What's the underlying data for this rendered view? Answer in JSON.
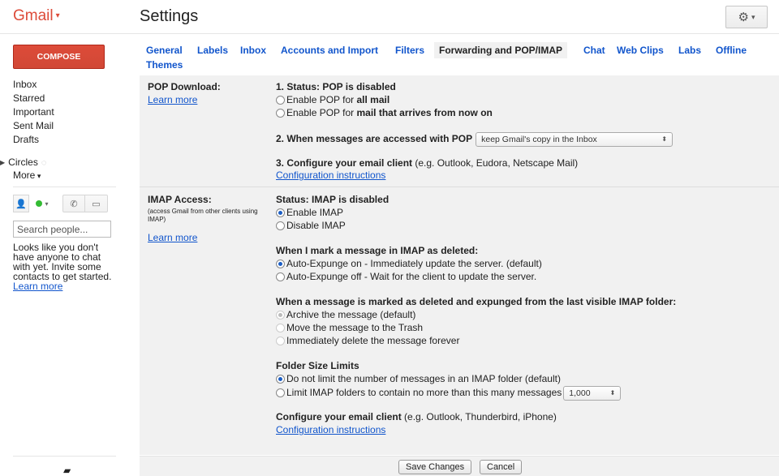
{
  "header": {
    "logo": "Gmail",
    "title": "Settings",
    "gear_icon": "gear-icon"
  },
  "sidebar": {
    "compose": "COMPOSE",
    "nav": [
      "Inbox",
      "Starred",
      "Important",
      "Sent Mail",
      "Drafts"
    ],
    "circles": "Circles",
    "more": "More",
    "search_placeholder": "Search people...",
    "chat_empty": "Looks like you don't have anyone to chat with yet. Invite some contacts to get started.",
    "chat_learn_more": "Learn more"
  },
  "tabs": [
    "General",
    "Labels",
    "Inbox",
    "Accounts and Import",
    "Filters",
    "Forwarding and POP/IMAP",
    "Chat",
    "Web Clips",
    "Labs",
    "Offline",
    "Themes"
  ],
  "active_tab": "Forwarding and POP/IMAP",
  "pop": {
    "heading": "POP Download:",
    "learn_more": "Learn more",
    "status": "1. Status: POP is disabled",
    "opt1_pre": "Enable POP for ",
    "opt1_bold": "all mail",
    "opt2_pre": "Enable POP for ",
    "opt2_bold": "mail that arrives from now on",
    "step2": "2. When messages are accessed with POP",
    "step2_select": "keep Gmail's copy in the Inbox",
    "step3_bold": "3. Configure your email client",
    "step3_rest": " (e.g. Outlook, Eudora, Netscape Mail)",
    "config_link": "Configuration instructions"
  },
  "imap": {
    "heading": "IMAP Access:",
    "sub": "(access Gmail from other clients using IMAP)",
    "learn_more": "Learn more",
    "status": "Status: IMAP is disabled",
    "enable": "Enable IMAP",
    "disable": "Disable IMAP",
    "deleted_heading": "When I mark a message in IMAP as deleted:",
    "expunge_on": "Auto-Expunge on - Immediately update the server. (default)",
    "expunge_off": "Auto-Expunge off - Wait for the client to update the server.",
    "expunged_heading": "When a message is marked as deleted and expunged from the last visible IMAP folder:",
    "archive": "Archive the message (default)",
    "trash": "Move the message to the Trash",
    "delete_forever": "Immediately delete the message forever",
    "folder_heading": "Folder Size Limits",
    "no_limit": "Do not limit the number of messages in an IMAP folder (default)",
    "limit": "Limit IMAP folders to contain no more than this many messages",
    "limit_select": "1,000",
    "config_bold": "Configure your email client",
    "config_rest": " (e.g. Outlook, Thunderbird, iPhone)",
    "config_link": "Configuration instructions"
  },
  "footer": {
    "save": "Save Changes",
    "cancel": "Cancel"
  }
}
